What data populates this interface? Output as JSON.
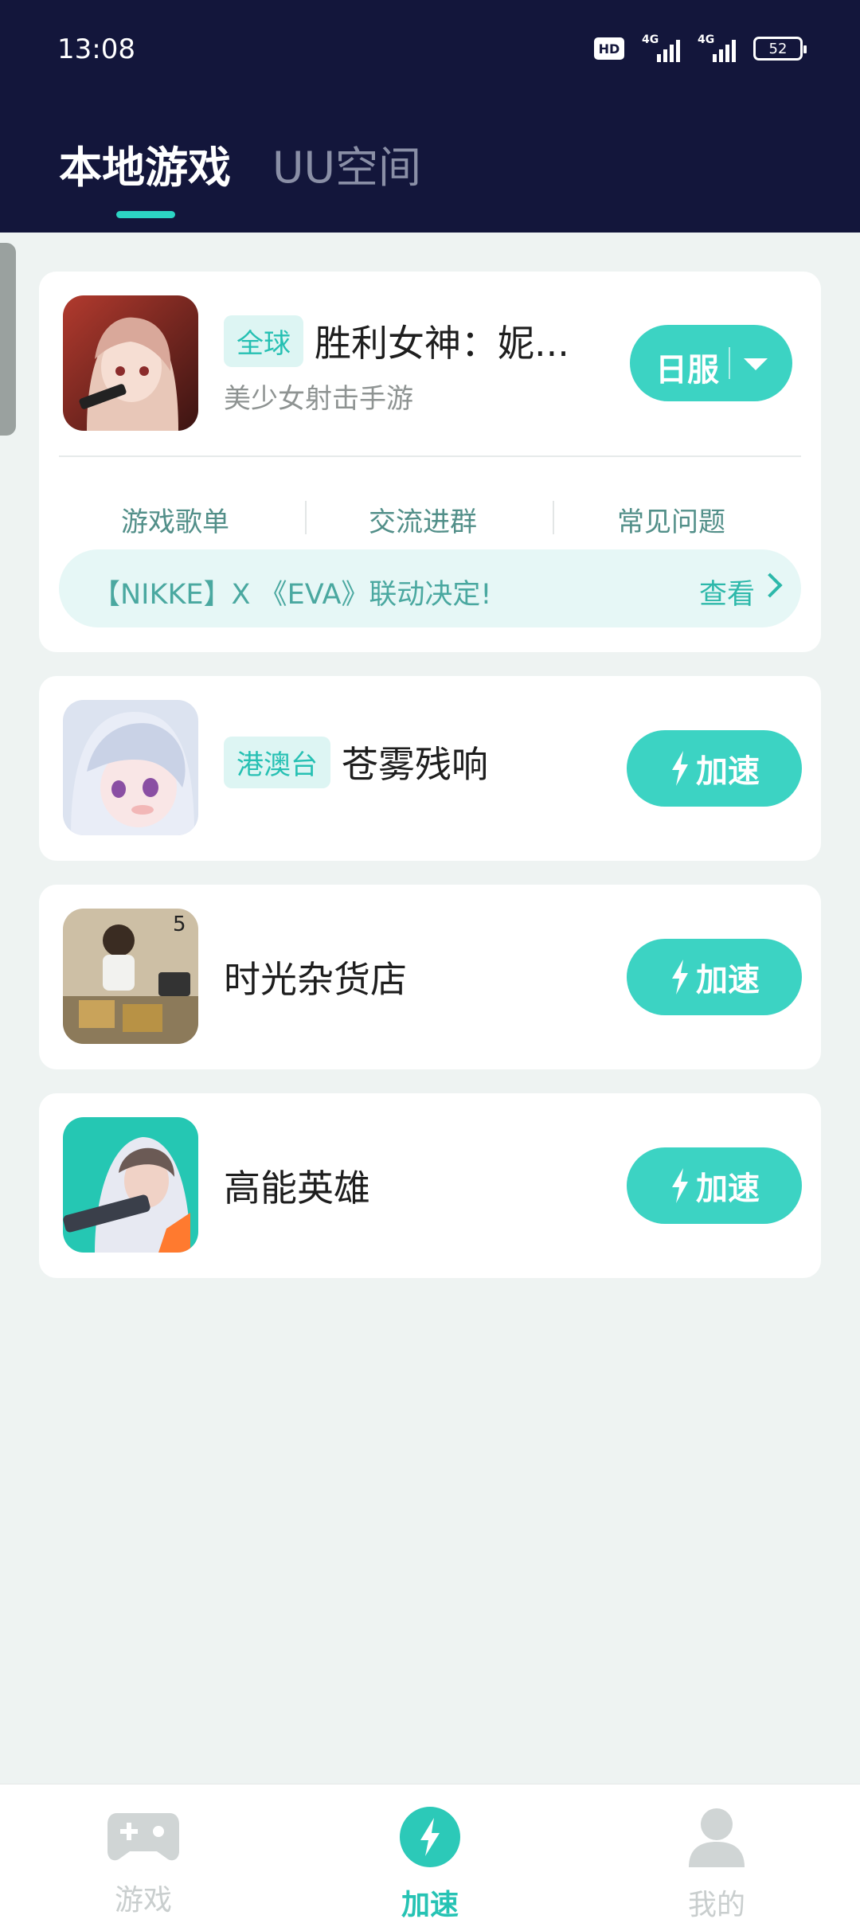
{
  "status_bar": {
    "time": "13:08",
    "hd": "HD",
    "network1": "4G",
    "network2": "4G",
    "battery": "52"
  },
  "top_tabs": {
    "local": "本地游戏",
    "uu_space": "UU空间"
  },
  "featured": {
    "badge": "全球",
    "title": "胜利女神：妮...",
    "subtitle": "美少女射击手游",
    "region_button": "日服",
    "links": [
      "游戏歌单",
      "交流进群",
      "常见问题"
    ],
    "news_text": "【NIKKE】X 《EVA》联动决定!",
    "news_view": "查看"
  },
  "games": [
    {
      "badge": "港澳台",
      "title": "苍雾残响",
      "button": "加速"
    },
    {
      "badge": "",
      "title": "时光杂货店",
      "button": "加速"
    },
    {
      "badge": "",
      "title": "高能英雄",
      "button": "加速"
    }
  ],
  "bottom_nav": {
    "games": "游戏",
    "accelerate": "加速",
    "mine": "我的"
  },
  "colors": {
    "header_bg": "#13163B",
    "accent": "#3CD3C3",
    "page_bg": "#EEF3F2"
  }
}
